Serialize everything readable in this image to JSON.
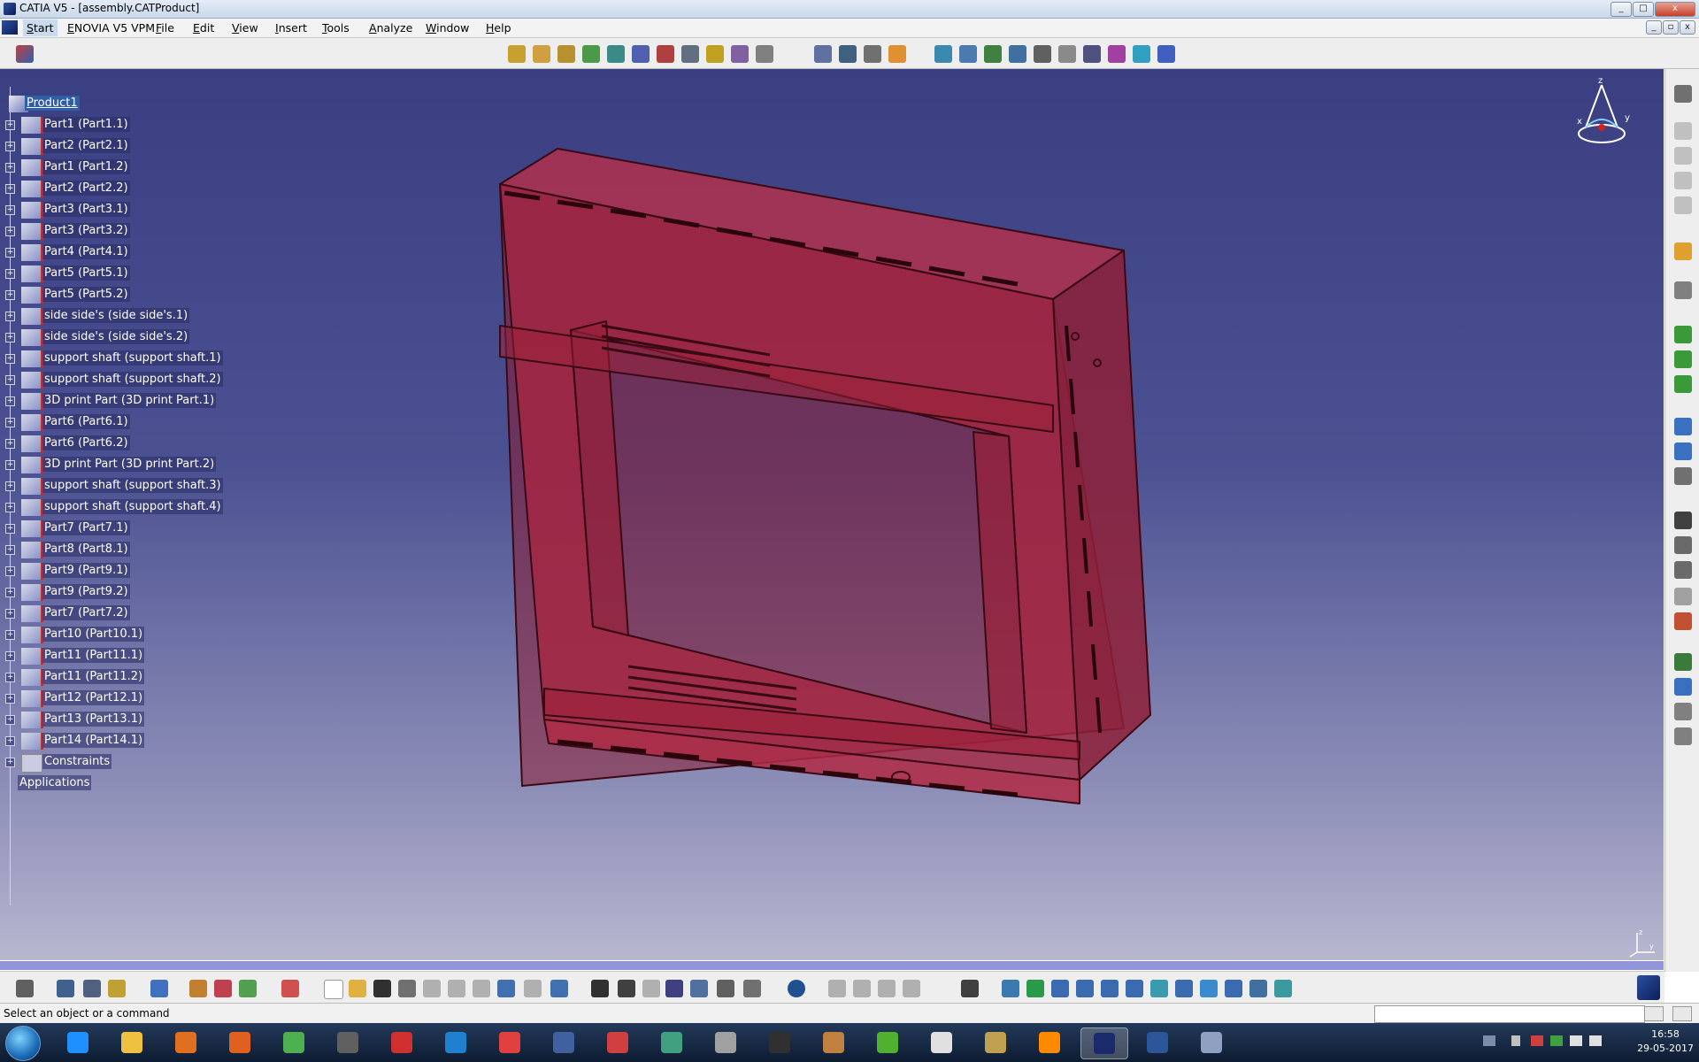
{
  "window": {
    "title": "CATIA V5 - [assembly.CATProduct]",
    "controls": [
      "_",
      "□",
      "x"
    ],
    "doc_controls": [
      "_",
      "▫",
      "x"
    ]
  },
  "menu": {
    "items": [
      "Start",
      "ENOVIA V5 VPM",
      "File",
      "Edit",
      "View",
      "Insert",
      "Tools",
      "Analyze",
      "Window",
      "Help"
    ]
  },
  "tree": {
    "root": "Product1",
    "items": [
      "Part1 (Part1.1)",
      "Part2 (Part2.1)",
      "Part1 (Part1.2)",
      "Part2 (Part2.2)",
      "Part3 (Part3.1)",
      "Part3 (Part3.2)",
      "Part4 (Part4.1)",
      "Part5 (Part5.1)",
      "Part5 (Part5.2)",
      "side side's (side side's.1)",
      "side side's (side side's.2)",
      "support shaft (support shaft.1)",
      "support shaft (support shaft.2)",
      "3D print Part (3D print Part.1)",
      "Part6 (Part6.1)",
      "Part6 (Part6.2)",
      "3D print Part (3D print Part.2)",
      "support shaft (support shaft.3)",
      "support shaft (support shaft.4)",
      "Part7 (Part7.1)",
      "Part8 (Part8.1)",
      "Part9 (Part9.1)",
      "Part9 (Part9.2)",
      "Part7 (Part7.2)",
      "Part10 (Part10.1)",
      "Part11 (Part11.1)",
      "Part11 (Part11.2)",
      "Part12 (Part12.1)",
      "Part13 (Part13.1)",
      "Part14 (Part14.1)"
    ],
    "constraints": "Constraints",
    "applications": "Applications"
  },
  "compass": {
    "x": "x",
    "y": "y",
    "z": "z"
  },
  "status": {
    "message": "Select an object or a command"
  },
  "taskbar": {
    "clock_time": "16:58",
    "clock_date": "29-05-2017",
    "apps": [
      "internet-explorer",
      "file-explorer",
      "media-player",
      "firefox",
      "chrome",
      "sketch-app",
      "pdf-app",
      "settings-app",
      "document-app",
      "network-app",
      "pdf-reader",
      "pinwheel-app",
      "cad-app",
      "inkscape-app",
      "archive-app",
      "vuze-app",
      "presentation-app",
      "stack-app",
      "illustrator",
      "catia",
      "word",
      "customizer-app"
    ]
  },
  "colors": {
    "viewport_top": "#3a3f82",
    "viewport_bottom": "#b6b7cf",
    "model_fill": "#a0203a",
    "model_edge": "#3a0a14",
    "selection": "#2f5ea8"
  }
}
